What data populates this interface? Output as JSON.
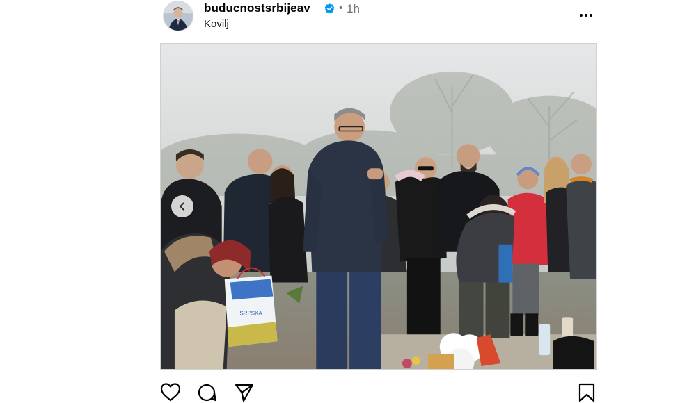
{
  "post": {
    "username": "buducnostsrbijeav",
    "verified": true,
    "separator": "•",
    "time": "1h",
    "location": "Kovilj"
  },
  "icons": {
    "more": "more-horizontal-icon",
    "verified": "verified-badge-icon",
    "prev": "chevron-left-icon",
    "like": "heart-icon",
    "comment": "comment-icon",
    "share": "send-icon",
    "save": "bookmark-icon"
  },
  "photo": {
    "bag_text": "SRPSKA"
  },
  "colors": {
    "verified_blue": "#0095f6",
    "secondary_text": "#737373"
  }
}
